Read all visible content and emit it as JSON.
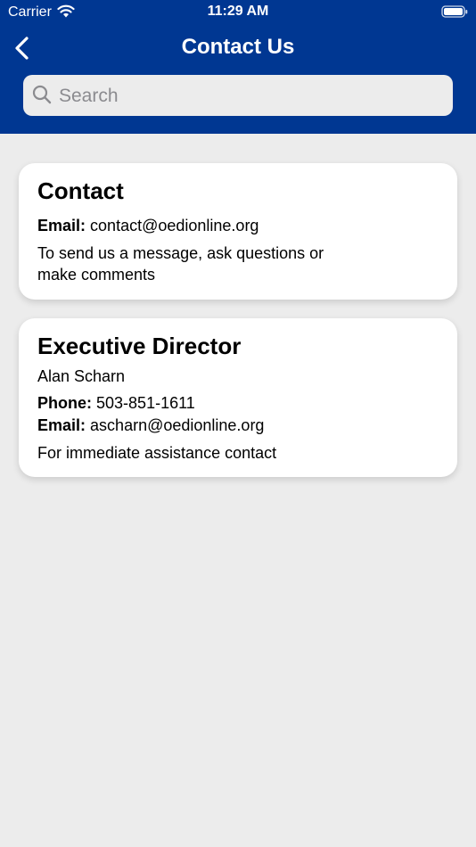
{
  "status_bar": {
    "carrier": "Carrier",
    "time": "11:29 AM"
  },
  "nav": {
    "title": "Contact Us"
  },
  "search": {
    "placeholder": "Search"
  },
  "cards": [
    {
      "title": "Contact",
      "email_label": "Email:",
      "email": "contact@oedionline.org",
      "description": "To send us a message, ask questions or make comments"
    },
    {
      "title": "Executive Director",
      "name": "Alan Scharn",
      "phone_label": "Phone:",
      "phone": "503-851-1611",
      "email_label": "Email:",
      "email": "ascharn@oedionline.org",
      "description": "For immediate assistance contact"
    }
  ],
  "colors": {
    "header": "#003792",
    "background": "#ececec",
    "card": "#ffffff"
  }
}
